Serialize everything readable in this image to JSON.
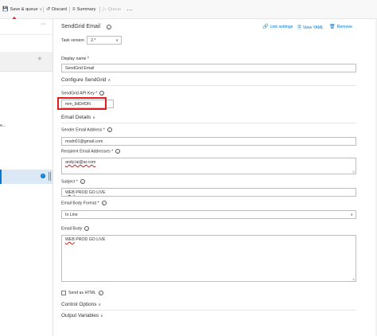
{
  "toolbar": {
    "save_queue": "Save & queue",
    "discard": "Discard",
    "summary": "Summary",
    "queue": "Queue",
    "more": "⋯"
  },
  "left": {
    "more": "⋯",
    "fragment": "e..."
  },
  "task": {
    "title": "SendGrid Email",
    "version_label": "Task version",
    "version_value": "2.*",
    "links": {
      "link_settings": "Link settings",
      "view_yaml": "View YAML",
      "remove": "Remove"
    }
  },
  "form": {
    "display_name_label": "Display name *",
    "display_name_value": "SendGrid Email",
    "configure_section": "Configure SendGrid",
    "api_key_label": "SendGrid API Key *",
    "api_key_value": "mm_9dDrfDFi",
    "email_section": "Email Details",
    "sender_label": "Sender Email Address *",
    "sender_value": "msdn01@gmail.com",
    "recipient_label": "Recipient Email Addresses *",
    "recipient_value": "andy.lai@ar.com",
    "subject_label": "Subject *",
    "subject_value_word": "WEB",
    "subject_value_rest": " PROD GO LIVE",
    "format_label": "Email Body Format *",
    "format_value": "In Line",
    "body_label": "Email Body",
    "body_value_word": "WEB",
    "body_value_rest": " PROD GO LIVE",
    "send_html_label": "Send as HTML",
    "control_options": "Control Options",
    "output_variables": "Output Variables"
  },
  "colors": {
    "accent": "#0078d4",
    "annotation": "#e02020"
  }
}
